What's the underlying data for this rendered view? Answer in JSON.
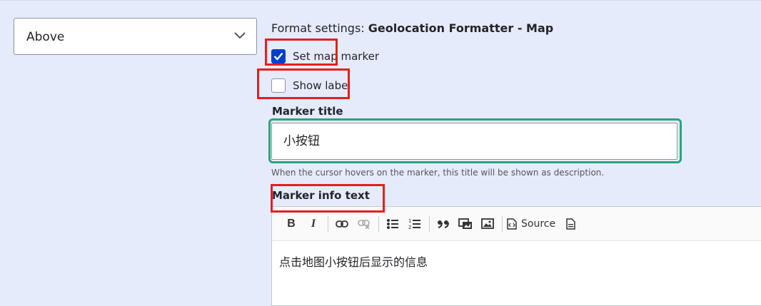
{
  "label_position_select": {
    "value": "Above"
  },
  "format_settings": {
    "prefix": "Format settings: ",
    "formatter_name": "Geolocation Formatter - Map"
  },
  "checkboxes": [
    {
      "label": "Set map marker",
      "checked": true
    },
    {
      "label": "Show label",
      "checked": false
    }
  ],
  "marker_title": {
    "label": "Marker title",
    "value": "小按钮",
    "description": "When the cursor hovers on the marker, this title will be shown as description."
  },
  "marker_info_text": {
    "label": "Marker info text",
    "toolbar": {
      "bold_label": "B",
      "italic_label": "I",
      "source_label": "Source"
    },
    "content": "点击地图小按钮后显示的信息"
  },
  "annotation_colors": {
    "red": "#e3201c",
    "green": "#2aa57a"
  },
  "accent_color": "#003ecc"
}
